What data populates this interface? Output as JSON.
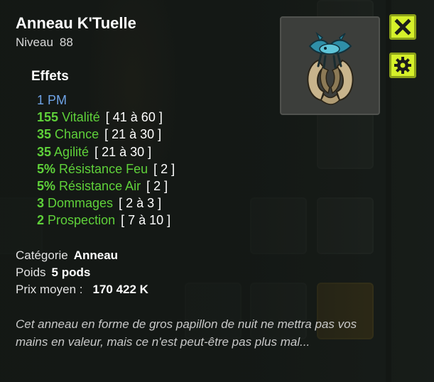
{
  "item": {
    "name": "Anneau K'Tuelle",
    "level_label": "Niveau",
    "level": "88"
  },
  "effects_title": "Effets",
  "effects": [
    {
      "value": "1 PM",
      "range": "",
      "color": "blue"
    },
    {
      "value": "155",
      "stat": "Vitalité",
      "range": "[ 41 à 60 ]"
    },
    {
      "value": "35",
      "stat": "Chance",
      "range": "[ 21 à 30 ]"
    },
    {
      "value": "35",
      "stat": "Agilité",
      "range": "[ 21 à 30 ]"
    },
    {
      "value": "5%",
      "stat": "Résistance Feu",
      "range": "[ 2 ]"
    },
    {
      "value": "5%",
      "stat": "Résistance Air",
      "range": "[ 2 ]"
    },
    {
      "value": "3",
      "stat": "Dommages",
      "range": "[ 2 à 3 ]"
    },
    {
      "value": "2",
      "stat": "Prospection",
      "range": "[ 7 à 10 ]"
    }
  ],
  "meta": {
    "category_label": "Catégorie",
    "category": "Anneau",
    "weight_label": "Poids",
    "weight": "5 pods",
    "price_label": "Prix moyen :",
    "price": "170 422 K"
  },
  "description": "Cet anneau en forme de gros papillon de nuit ne mettra pas vos mains en valeur, mais ce n'est peut-être pas plus mal...",
  "colors": {
    "effect_green": "#5fd13a",
    "effect_blue": "#6fa3e6",
    "button_accent": "#d6f02a"
  },
  "icons": {
    "close": "close-icon",
    "settings": "gear-icon",
    "item": "ring-moth-icon"
  }
}
